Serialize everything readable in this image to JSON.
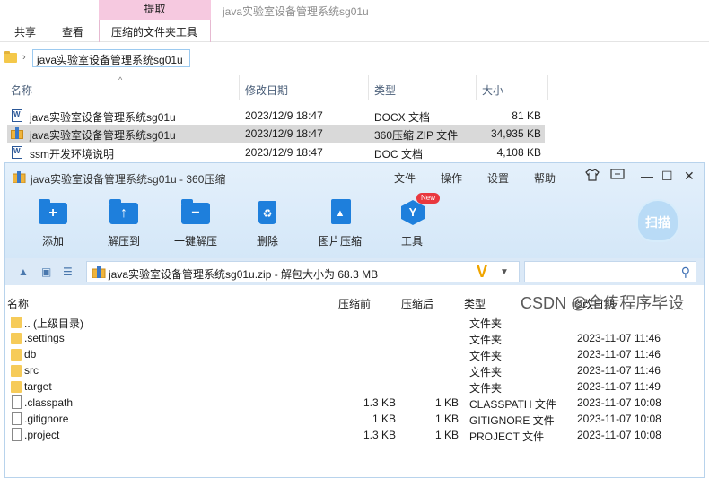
{
  "explorer": {
    "context_tab": "提取",
    "window_title": "java实验室设备管理系统sg01u",
    "tabs": [
      "共享",
      "查看",
      "压缩的文件夹工具"
    ],
    "address": "java实验室设备管理系统sg01u",
    "columns": [
      "名称",
      "修改日期",
      "类型",
      "大小"
    ],
    "files": [
      {
        "name": "java实验室设备管理系统sg01u",
        "date": "2023/12/9 18:47",
        "type": "DOCX 文档",
        "size": "81 KB",
        "icon": "word-doc-icon"
      },
      {
        "name": "java实验室设备管理系统sg01u",
        "date": "2023/12/9 18:47",
        "type": "360压缩 ZIP 文件",
        "size": "34,935 KB",
        "icon": "zip-icon"
      },
      {
        "name": "ssm开发环境说明",
        "date": "2023/12/9 18:47",
        "type": "DOC 文档",
        "size": "4,108 KB",
        "icon": "word-doc-icon"
      }
    ]
  },
  "zip_app": {
    "title": "java实验室设备管理系统sg01u - 360压缩",
    "menu": [
      "文件",
      "操作",
      "设置",
      "帮助"
    ],
    "tools": [
      {
        "label": "添加",
        "icon": "add-folder-icon"
      },
      {
        "label": "解压到",
        "icon": "extract-to-icon"
      },
      {
        "label": "一键解压",
        "icon": "one-click-extract-icon"
      },
      {
        "label": "删除",
        "icon": "delete-bin-icon"
      },
      {
        "label": "图片压缩",
        "icon": "image-compress-icon"
      },
      {
        "label": "工具",
        "icon": "tools-icon"
      }
    ],
    "new_badge": "New",
    "scan_label": "扫描",
    "path_text": "java实验室设备管理系统sg01u.zip - 解包大小为 68.3 MB",
    "columns": [
      "名称",
      "压缩前",
      "压缩后",
      "类型",
      "修改日期"
    ],
    "rows": [
      {
        "name": ".. (上级目录)",
        "before": "",
        "after": "",
        "type": "文件夹",
        "date": "",
        "icon": "folder-icon"
      },
      {
        "name": ".settings",
        "before": "",
        "after": "",
        "type": "文件夹",
        "date": "2023-11-07 11:46",
        "icon": "folder-icon"
      },
      {
        "name": "db",
        "before": "",
        "after": "",
        "type": "文件夹",
        "date": "2023-11-07 11:46",
        "icon": "folder-icon"
      },
      {
        "name": "src",
        "before": "",
        "after": "",
        "type": "文件夹",
        "date": "2023-11-07 11:46",
        "icon": "folder-icon"
      },
      {
        "name": "target",
        "before": "",
        "after": "",
        "type": "文件夹",
        "date": "2023-11-07 11:49",
        "icon": "folder-icon"
      },
      {
        "name": ".classpath",
        "before": "1.3 KB",
        "after": "1 KB",
        "type": "CLASSPATH 文件",
        "date": "2023-11-07 10:08",
        "icon": "file-icon"
      },
      {
        "name": ".gitignore",
        "before": "1 KB",
        "after": "1 KB",
        "type": "GITIGNORE 文件",
        "date": "2023-11-07 10:08",
        "icon": "file-icon"
      },
      {
        "name": ".project",
        "before": "1.3 KB",
        "after": "1 KB",
        "type": "PROJECT 文件",
        "date": "2023-11-07 10:08",
        "icon": "file-icon"
      }
    ]
  },
  "watermark": "CSDN @全传程序毕设"
}
